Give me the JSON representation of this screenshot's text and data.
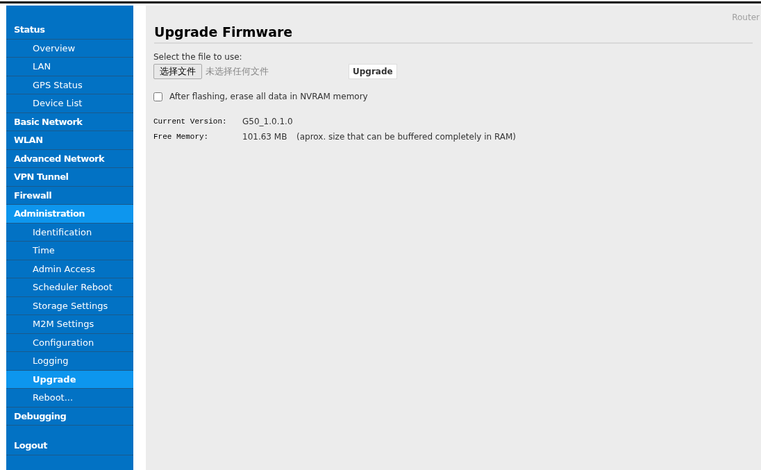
{
  "sidebar": {
    "items": [
      {
        "label": "Status",
        "kind": "section",
        "selected": false
      },
      {
        "label": "Overview",
        "kind": "sub",
        "selected": false
      },
      {
        "label": "LAN",
        "kind": "sub",
        "selected": false
      },
      {
        "label": "GPS Status",
        "kind": "sub",
        "selected": false
      },
      {
        "label": "Device List",
        "kind": "sub",
        "selected": false
      },
      {
        "label": "Basic Network",
        "kind": "section",
        "selected": false
      },
      {
        "label": "WLAN",
        "kind": "section",
        "selected": false
      },
      {
        "label": "Advanced Network",
        "kind": "section",
        "selected": false
      },
      {
        "label": "VPN Tunnel",
        "kind": "section",
        "selected": false
      },
      {
        "label": "Firewall",
        "kind": "section",
        "selected": false
      },
      {
        "label": "Administration",
        "kind": "section",
        "selected": true
      },
      {
        "label": "Identification",
        "kind": "sub",
        "selected": false
      },
      {
        "label": "Time",
        "kind": "sub",
        "selected": false
      },
      {
        "label": "Admin Access",
        "kind": "sub",
        "selected": false
      },
      {
        "label": "Scheduler Reboot",
        "kind": "sub",
        "selected": false
      },
      {
        "label": "Storage Settings",
        "kind": "sub",
        "selected": false
      },
      {
        "label": "M2M Settings",
        "kind": "sub",
        "selected": false
      },
      {
        "label": "Configuration",
        "kind": "sub",
        "selected": false
      },
      {
        "label": "Logging",
        "kind": "sub",
        "selected": false
      },
      {
        "label": "Upgrade",
        "kind": "sub",
        "selected": true
      },
      {
        "label": "Reboot...",
        "kind": "sub",
        "selected": false
      },
      {
        "label": "Debugging",
        "kind": "section",
        "selected": false
      }
    ],
    "logout": "Logout"
  },
  "header": {
    "brand": "Router"
  },
  "main": {
    "title": "Upgrade Firmware",
    "file_label": "Select the file to use:",
    "file_button": "选择文件",
    "file_status": "未选择任何文件",
    "upgrade_button": "Upgrade",
    "erase_option": {
      "label": "After flashing, erase all data in NVRAM memory",
      "checked": false
    },
    "info": [
      {
        "label": "Current Version:",
        "value": "G50_1.0.1.0"
      },
      {
        "label": "Free Memory:",
        "value": "101.63 MB",
        "note": "(aprox. size that can be buffered completely in RAM)"
      }
    ]
  }
}
